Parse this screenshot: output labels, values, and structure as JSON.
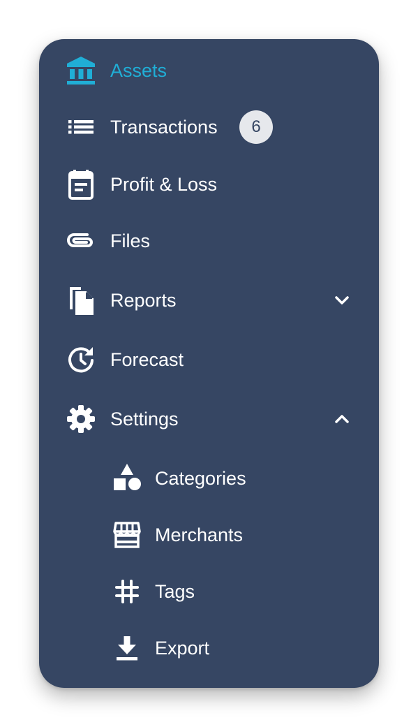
{
  "colors": {
    "panel_bg": "#364663",
    "active_text": "#20aed6",
    "text": "#ffffff",
    "badge_bg": "#e6e8ec",
    "badge_text": "#364663"
  },
  "nav": {
    "items": [
      {
        "label": "Assets",
        "icon": "bank-icon",
        "active": true
      },
      {
        "label": "Transactions",
        "icon": "list-icon",
        "badge": "6"
      },
      {
        "label": "Profit & Loss",
        "icon": "calendar-icon"
      },
      {
        "label": "Files",
        "icon": "paperclip-icon"
      },
      {
        "label": "Reports",
        "icon": "documents-icon",
        "expanded": false
      },
      {
        "label": "Forecast",
        "icon": "history-icon"
      },
      {
        "label": "Settings",
        "icon": "gear-icon",
        "expanded": true
      }
    ],
    "subitems": [
      {
        "label": "Categories",
        "icon": "shapes-icon"
      },
      {
        "label": "Merchants",
        "icon": "store-icon"
      },
      {
        "label": "Tags",
        "icon": "hashtag-icon"
      },
      {
        "label": "Export",
        "icon": "download-icon"
      }
    ]
  }
}
